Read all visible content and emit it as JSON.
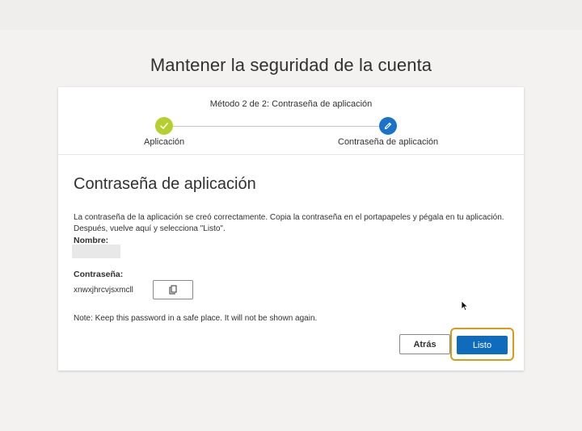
{
  "page": {
    "title": "Mantener la seguridad de la cuenta"
  },
  "stepper": {
    "heading": "Método 2 de 2: Contraseña de aplicación",
    "steps": [
      {
        "label": "Aplicación",
        "status": "done",
        "icon": "check-icon"
      },
      {
        "label": "Contraseña de aplicación",
        "status": "current",
        "icon": "pencil-icon"
      }
    ]
  },
  "content": {
    "section_title": "Contraseña de aplicación",
    "description": "La contraseña de la aplicación se creó correctamente. Copia la contraseña en el portapapeles y pégala en tu aplicación. Después, vuelve aquí y selecciona \"Listo\".",
    "name_label": "Nombre:",
    "password_label": "Contraseña:",
    "password_value": "xnwxjhrcvjsxmcll",
    "copy_icon": "copy-icon",
    "note": "Note: Keep this password in a safe place. It will not be shown again."
  },
  "actions": {
    "back_label": "Atrás",
    "done_label": "Listo"
  },
  "colors": {
    "accent": "#0f6cbd",
    "step_done": "#b4cf2e",
    "step_current": "#1a73c9",
    "highlight": "#d89b14"
  }
}
